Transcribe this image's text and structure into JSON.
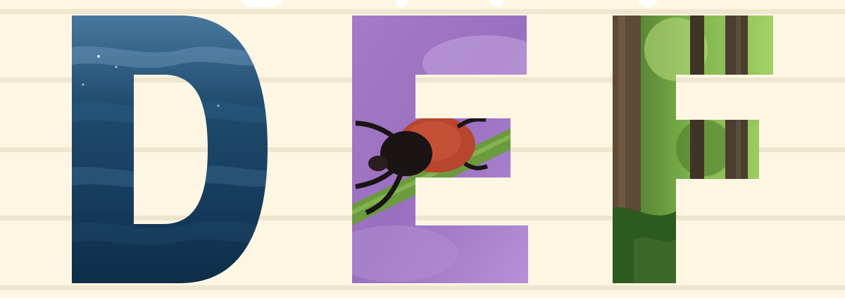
{
  "letters": [
    "D",
    "E",
    "F"
  ],
  "themes": {
    "D": "ocean-water",
    "E": "tick-on-purple-flower",
    "F": "forest-trees"
  },
  "colors": {
    "background": "#fdf6e3",
    "rule": "#efe6cf",
    "ocean_dark": "#0f2f4a",
    "ocean_light": "#5a85a6",
    "purple_light": "#c3a5dd",
    "purple_dark": "#9266b8",
    "tick_body": "#b8452d",
    "tick_head": "#1b1414",
    "leaf_green": "#6b9a3f",
    "forest_light": "#b5d77a",
    "forest_dark": "#2d5a1e",
    "bark": "#5e4a35"
  }
}
